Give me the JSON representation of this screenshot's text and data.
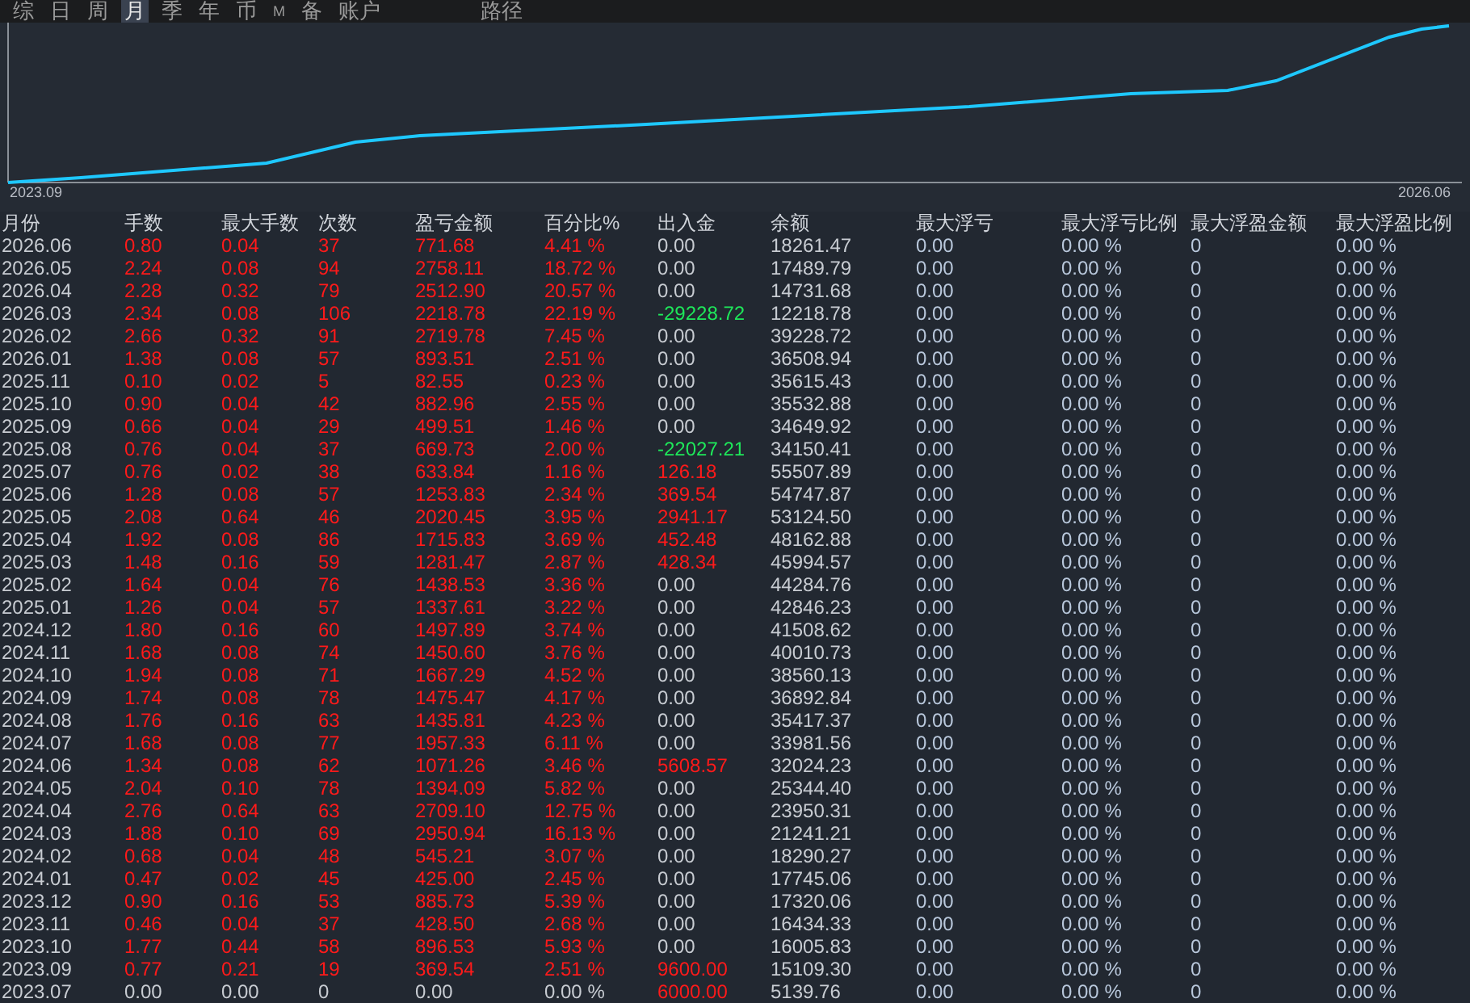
{
  "tabs": [
    {
      "label": "综",
      "selected": false,
      "kind": "normal"
    },
    {
      "label": "日",
      "selected": false,
      "kind": "normal"
    },
    {
      "label": "周",
      "selected": false,
      "kind": "normal"
    },
    {
      "label": "月",
      "selected": true,
      "kind": "normal"
    },
    {
      "label": "季",
      "selected": false,
      "kind": "normal"
    },
    {
      "label": "年",
      "selected": false,
      "kind": "normal"
    },
    {
      "label": "币",
      "selected": false,
      "kind": "normal"
    },
    {
      "label": "M",
      "selected": false,
      "kind": "small"
    },
    {
      "label": "备",
      "selected": false,
      "kind": "normal"
    },
    {
      "label": "账户",
      "selected": false,
      "kind": "normal"
    },
    {
      "label": "路径",
      "selected": false,
      "kind": "spaced"
    }
  ],
  "chart": {
    "start_label": "2023.09",
    "end_label": "2026.06"
  },
  "table": {
    "columns": [
      "月份",
      "手数",
      "最大手数",
      "次数",
      "盈亏金额",
      "百分比%",
      "出入金",
      "余额",
      "最大浮亏",
      "最大浮亏比例",
      "最大浮盈金额",
      "最大浮盈比例"
    ],
    "rows": [
      {
        "profit": true,
        "withdrawal": false,
        "deposit": false,
        "cells": [
          "2026.06",
          "0.80",
          "0.04",
          "37",
          "771.68",
          "4.41 %",
          "0.00",
          "18261.47",
          "0.00",
          "0.00 %",
          "0",
          "0.00 %"
        ]
      },
      {
        "profit": true,
        "withdrawal": false,
        "deposit": false,
        "cells": [
          "2026.05",
          "2.24",
          "0.08",
          "94",
          "2758.11",
          "18.72 %",
          "0.00",
          "17489.79",
          "0.00",
          "0.00 %",
          "0",
          "0.00 %"
        ]
      },
      {
        "profit": true,
        "withdrawal": false,
        "deposit": false,
        "cells": [
          "2026.04",
          "2.28",
          "0.32",
          "79",
          "2512.90",
          "20.57 %",
          "0.00",
          "14731.68",
          "0.00",
          "0.00 %",
          "0",
          "0.00 %"
        ]
      },
      {
        "profit": true,
        "withdrawal": true,
        "deposit": false,
        "cells": [
          "2026.03",
          "2.34",
          "0.08",
          "106",
          "2218.78",
          "22.19 %",
          "-29228.72",
          "12218.78",
          "0.00",
          "0.00 %",
          "0",
          "0.00 %"
        ]
      },
      {
        "profit": true,
        "withdrawal": false,
        "deposit": false,
        "cells": [
          "2026.02",
          "2.66",
          "0.32",
          "91",
          "2719.78",
          "7.45 %",
          "0.00",
          "39228.72",
          "0.00",
          "0.00 %",
          "0",
          "0.00 %"
        ]
      },
      {
        "profit": true,
        "withdrawal": false,
        "deposit": false,
        "cells": [
          "2026.01",
          "1.38",
          "0.08",
          "57",
          "893.51",
          "2.51 %",
          "0.00",
          "36508.94",
          "0.00",
          "0.00 %",
          "0",
          "0.00 %"
        ]
      },
      {
        "profit": true,
        "withdrawal": false,
        "deposit": false,
        "cells": [
          "2025.11",
          "0.10",
          "0.02",
          "5",
          "82.55",
          "0.23 %",
          "0.00",
          "35615.43",
          "0.00",
          "0.00 %",
          "0",
          "0.00 %"
        ]
      },
      {
        "profit": true,
        "withdrawal": false,
        "deposit": false,
        "cells": [
          "2025.10",
          "0.90",
          "0.04",
          "42",
          "882.96",
          "2.55 %",
          "0.00",
          "35532.88",
          "0.00",
          "0.00 %",
          "0",
          "0.00 %"
        ]
      },
      {
        "profit": true,
        "withdrawal": false,
        "deposit": false,
        "cells": [
          "2025.09",
          "0.66",
          "0.04",
          "29",
          "499.51",
          "1.46 %",
          "0.00",
          "34649.92",
          "0.00",
          "0.00 %",
          "0",
          "0.00 %"
        ]
      },
      {
        "profit": true,
        "withdrawal": true,
        "deposit": false,
        "cells": [
          "2025.08",
          "0.76",
          "0.04",
          "37",
          "669.73",
          "2.00 %",
          "-22027.21",
          "34150.41",
          "0.00",
          "0.00 %",
          "0",
          "0.00 %"
        ]
      },
      {
        "profit": true,
        "withdrawal": false,
        "deposit": true,
        "cells": [
          "2025.07",
          "0.76",
          "0.02",
          "38",
          "633.84",
          "1.16 %",
          "126.18",
          "55507.89",
          "0.00",
          "0.00 %",
          "0",
          "0.00 %"
        ]
      },
      {
        "profit": true,
        "withdrawal": false,
        "deposit": true,
        "cells": [
          "2025.06",
          "1.28",
          "0.08",
          "57",
          "1253.83",
          "2.34 %",
          "369.54",
          "54747.87",
          "0.00",
          "0.00 %",
          "0",
          "0.00 %"
        ]
      },
      {
        "profit": true,
        "withdrawal": false,
        "deposit": true,
        "cells": [
          "2025.05",
          "2.08",
          "0.64",
          "46",
          "2020.45",
          "3.95 %",
          "2941.17",
          "53124.50",
          "0.00",
          "0.00 %",
          "0",
          "0.00 %"
        ]
      },
      {
        "profit": true,
        "withdrawal": false,
        "deposit": true,
        "cells": [
          "2025.04",
          "1.92",
          "0.08",
          "86",
          "1715.83",
          "3.69 %",
          "452.48",
          "48162.88",
          "0.00",
          "0.00 %",
          "0",
          "0.00 %"
        ]
      },
      {
        "profit": true,
        "withdrawal": false,
        "deposit": true,
        "cells": [
          "2025.03",
          "1.48",
          "0.16",
          "59",
          "1281.47",
          "2.87 %",
          "428.34",
          "45994.57",
          "0.00",
          "0.00 %",
          "0",
          "0.00 %"
        ]
      },
      {
        "profit": true,
        "withdrawal": false,
        "deposit": false,
        "cells": [
          "2025.02",
          "1.64",
          "0.04",
          "76",
          "1438.53",
          "3.36 %",
          "0.00",
          "44284.76",
          "0.00",
          "0.00 %",
          "0",
          "0.00 %"
        ]
      },
      {
        "profit": true,
        "withdrawal": false,
        "deposit": false,
        "cells": [
          "2025.01",
          "1.26",
          "0.04",
          "57",
          "1337.61",
          "3.22 %",
          "0.00",
          "42846.23",
          "0.00",
          "0.00 %",
          "0",
          "0.00 %"
        ]
      },
      {
        "profit": true,
        "withdrawal": false,
        "deposit": false,
        "cells": [
          "2024.12",
          "1.80",
          "0.16",
          "60",
          "1497.89",
          "3.74 %",
          "0.00",
          "41508.62",
          "0.00",
          "0.00 %",
          "0",
          "0.00 %"
        ]
      },
      {
        "profit": true,
        "withdrawal": false,
        "deposit": false,
        "cells": [
          "2024.11",
          "1.68",
          "0.08",
          "74",
          "1450.60",
          "3.76 %",
          "0.00",
          "40010.73",
          "0.00",
          "0.00 %",
          "0",
          "0.00 %"
        ]
      },
      {
        "profit": true,
        "withdrawal": false,
        "deposit": false,
        "cells": [
          "2024.10",
          "1.94",
          "0.08",
          "71",
          "1667.29",
          "4.52 %",
          "0.00",
          "38560.13",
          "0.00",
          "0.00 %",
          "0",
          "0.00 %"
        ]
      },
      {
        "profit": true,
        "withdrawal": false,
        "deposit": false,
        "cells": [
          "2024.09",
          "1.74",
          "0.08",
          "78",
          "1475.47",
          "4.17 %",
          "0.00",
          "36892.84",
          "0.00",
          "0.00 %",
          "0",
          "0.00 %"
        ]
      },
      {
        "profit": true,
        "withdrawal": false,
        "deposit": false,
        "cells": [
          "2024.08",
          "1.76",
          "0.16",
          "63",
          "1435.81",
          "4.23 %",
          "0.00",
          "35417.37",
          "0.00",
          "0.00 %",
          "0",
          "0.00 %"
        ]
      },
      {
        "profit": true,
        "withdrawal": false,
        "deposit": false,
        "cells": [
          "2024.07",
          "1.68",
          "0.08",
          "77",
          "1957.33",
          "6.11 %",
          "0.00",
          "33981.56",
          "0.00",
          "0.00 %",
          "0",
          "0.00 %"
        ]
      },
      {
        "profit": true,
        "withdrawal": false,
        "deposit": true,
        "cells": [
          "2024.06",
          "1.34",
          "0.08",
          "62",
          "1071.26",
          "3.46 %",
          "5608.57",
          "32024.23",
          "0.00",
          "0.00 %",
          "0",
          "0.00 %"
        ]
      },
      {
        "profit": true,
        "withdrawal": false,
        "deposit": false,
        "cells": [
          "2024.05",
          "2.04",
          "0.10",
          "78",
          "1394.09",
          "5.82 %",
          "0.00",
          "25344.40",
          "0.00",
          "0.00 %",
          "0",
          "0.00 %"
        ]
      },
      {
        "profit": true,
        "withdrawal": false,
        "deposit": false,
        "cells": [
          "2024.04",
          "2.76",
          "0.64",
          "63",
          "2709.10",
          "12.75 %",
          "0.00",
          "23950.31",
          "0.00",
          "0.00 %",
          "0",
          "0.00 %"
        ]
      },
      {
        "profit": true,
        "withdrawal": false,
        "deposit": false,
        "cells": [
          "2024.03",
          "1.88",
          "0.10",
          "69",
          "2950.94",
          "16.13 %",
          "0.00",
          "21241.21",
          "0.00",
          "0.00 %",
          "0",
          "0.00 %"
        ]
      },
      {
        "profit": true,
        "withdrawal": false,
        "deposit": false,
        "cells": [
          "2024.02",
          "0.68",
          "0.04",
          "48",
          "545.21",
          "3.07 %",
          "0.00",
          "18290.27",
          "0.00",
          "0.00 %",
          "0",
          "0.00 %"
        ]
      },
      {
        "profit": true,
        "withdrawal": false,
        "deposit": false,
        "cells": [
          "2024.01",
          "0.47",
          "0.02",
          "45",
          "425.00",
          "2.45 %",
          "0.00",
          "17745.06",
          "0.00",
          "0.00 %",
          "0",
          "0.00 %"
        ]
      },
      {
        "profit": true,
        "withdrawal": false,
        "deposit": false,
        "cells": [
          "2023.12",
          "0.90",
          "0.16",
          "53",
          "885.73",
          "5.39 %",
          "0.00",
          "17320.06",
          "0.00",
          "0.00 %",
          "0",
          "0.00 %"
        ]
      },
      {
        "profit": true,
        "withdrawal": false,
        "deposit": false,
        "cells": [
          "2023.11",
          "0.46",
          "0.04",
          "37",
          "428.50",
          "2.68 %",
          "0.00",
          "16434.33",
          "0.00",
          "0.00 %",
          "0",
          "0.00 %"
        ]
      },
      {
        "profit": true,
        "withdrawal": false,
        "deposit": false,
        "cells": [
          "2023.10",
          "1.77",
          "0.44",
          "58",
          "896.53",
          "5.93 %",
          "0.00",
          "16005.83",
          "0.00",
          "0.00 %",
          "0",
          "0.00 %"
        ]
      },
      {
        "profit": true,
        "withdrawal": false,
        "deposit": true,
        "cells": [
          "2023.09",
          "0.77",
          "0.21",
          "19",
          "369.54",
          "2.51 %",
          "9600.00",
          "15109.30",
          "0.00",
          "0.00 %",
          "0",
          "0.00 %"
        ]
      },
      {
        "profit": false,
        "withdrawal": false,
        "deposit": true,
        "cells": [
          "2023.07",
          "0.00",
          "0.00",
          "0",
          "0.00",
          "0.00 %",
          "6000.00",
          "5139.76",
          "0.00",
          "0.00 %",
          "0",
          "0.00 %"
        ]
      }
    ]
  }
}
